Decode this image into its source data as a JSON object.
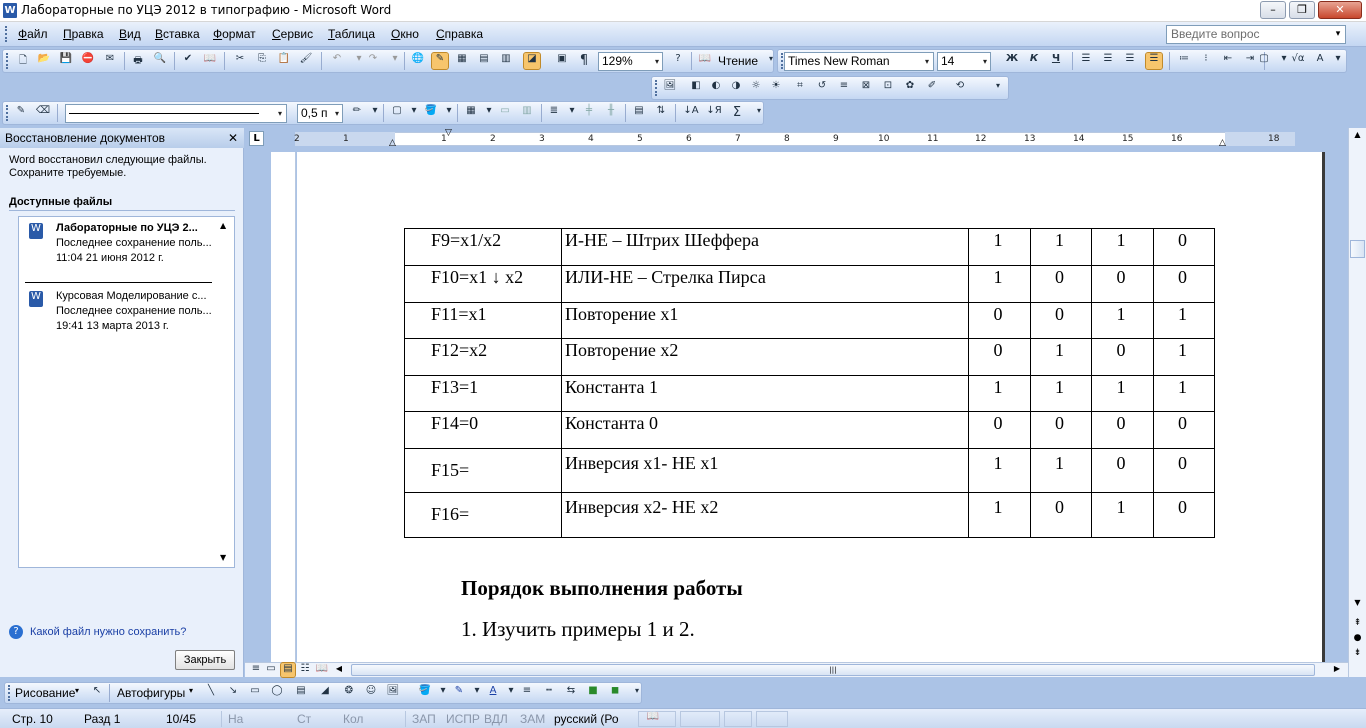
{
  "window": {
    "title": "Лабораторные по УЦЭ 2012 в типографию - Microsoft Word",
    "app_icon": "W",
    "minimize": "–",
    "restore": "❐",
    "close": "✕"
  },
  "menu": {
    "items": [
      "Файл",
      "Правка",
      "Вид",
      "Вставка",
      "Формат",
      "Сервис",
      "Таблица",
      "Окно",
      "Справка"
    ],
    "help_placeholder": "Введите вопрос",
    "help_arrow": "▾"
  },
  "standard_toolbar": {
    "zoom": "129%",
    "read_button": "Чтение",
    "paragraph_icon": "¶"
  },
  "formatting_toolbar": {
    "font": "Times New Roman",
    "size": "14",
    "bold": "Ж",
    "italic": "К",
    "underline": "Ч"
  },
  "tables_toolbar": {
    "line_weight": "0,5 п",
    "sum_icon": "Σ"
  },
  "task_pane": {
    "title": "Восстановление документов",
    "intro_line1": "Word восстановил следующие файлы.",
    "intro_line2": "Сохраните требуемые.",
    "available_files": "Доступные файлы",
    "files": [
      {
        "name": "Лабораторные по УЦЭ 2...",
        "status": "Последнее сохранение поль...",
        "date": "11:04 21 июня 2012 г."
      },
      {
        "name": "Курсовая Моделирование с...",
        "status": "Последнее сохранение поль...",
        "date": "19:41 13 марта 2013 г."
      }
    ],
    "help_link": "Какой файл нужно сохранить?",
    "close_button": "Закрыть"
  },
  "ruler": {
    "numbers": [
      "2",
      "1",
      "1",
      "2",
      "3",
      "4",
      "5",
      "6",
      "7",
      "8",
      "9",
      "10",
      "11",
      "12",
      "13",
      "14",
      "15",
      "16",
      "18"
    ]
  },
  "document": {
    "table_rows": [
      {
        "func": "F9=x1/x2",
        "name": "И-НЕ – Штрих Шеффера",
        "v": [
          "1",
          "1",
          "1",
          "0"
        ]
      },
      {
        "func": "F10=x1 ↓ x2",
        "name": "ИЛИ-НЕ – Стрелка Пирса",
        "v": [
          "1",
          "0",
          "0",
          "0"
        ]
      },
      {
        "func": "F11=x1",
        "name": "Повторение x1",
        "v": [
          "0",
          "0",
          "1",
          "1"
        ]
      },
      {
        "func": "F12=x2",
        "name": "Повторение x2",
        "v": [
          "0",
          "1",
          "0",
          "1"
        ]
      },
      {
        "func": "F13=1",
        "name": "Константа 1",
        "v": [
          "1",
          "1",
          "1",
          "1"
        ]
      },
      {
        "func": "F14=0",
        "name": "Константа 0",
        "v": [
          "0",
          "0",
          "0",
          "0"
        ]
      },
      {
        "func": "F15=",
        "name": "Инверсия x1- НЕ x1",
        "v": [
          "1",
          "1",
          "0",
          "0"
        ]
      },
      {
        "func": "F16=",
        "name": "Инверсия x2- НЕ x2",
        "v": [
          "1",
          "0",
          "1",
          "0"
        ]
      }
    ],
    "heading": "Порядок выполнения работы",
    "list_item_1": "1.  Изучить примеры 1 и 2."
  },
  "drawing_toolbar": {
    "draw_menu": "Рисование",
    "autoshapes": "Автофигуры"
  },
  "status_bar": {
    "page": "Стр.  10",
    "section": "Разд  1",
    "pages": "10/45",
    "at": "На",
    "line": "Ст",
    "col": "Кол",
    "rec": "ЗАП",
    "trk": "ИСПР",
    "ext": "ВДЛ",
    "ovr": "ЗАМ",
    "language": "русский (Ро"
  }
}
